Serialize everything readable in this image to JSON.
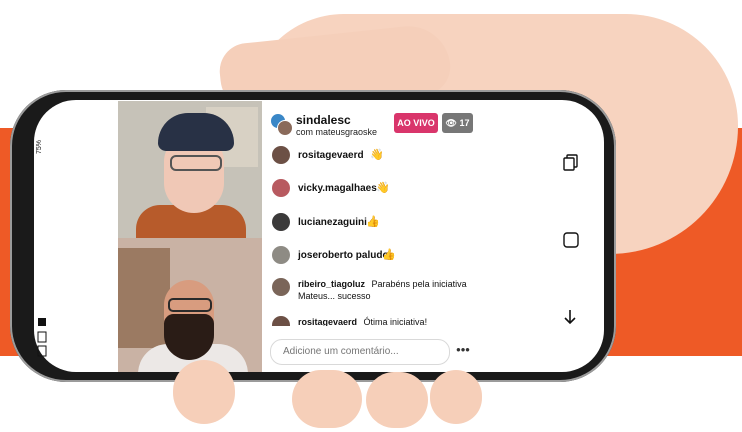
{
  "status_bar": {
    "battery": "75%"
  },
  "stream": {
    "host_name": "sindalesc",
    "host_with": "com mateusgraoske",
    "live_label": "AO VIVO",
    "viewer_count": "17"
  },
  "comments": [
    {
      "user": "rositagevaerd",
      "text": "",
      "emoji": "👋"
    },
    {
      "user": "vicky.magalhaes",
      "text": "",
      "emoji": "👋"
    },
    {
      "user": "lucianezaguini",
      "text": "",
      "emoji": "👍"
    },
    {
      "user": "joseroberto paludo",
      "text": "",
      "emoji": "👍"
    },
    {
      "user": "ribeiro_tiagoluz",
      "text": "Parabéns pela iniciativa Mateus... sucesso",
      "emoji": ""
    },
    {
      "user": "rositagevaerd",
      "text": "Ótima iniciativa!",
      "emoji": ""
    }
  ],
  "input": {
    "placeholder": "Adicione um comentário..."
  },
  "more_label": "•••",
  "colors": {
    "live": "#d9356b",
    "accent_band": "#ee5a26",
    "viewer_badge": "#777777"
  }
}
